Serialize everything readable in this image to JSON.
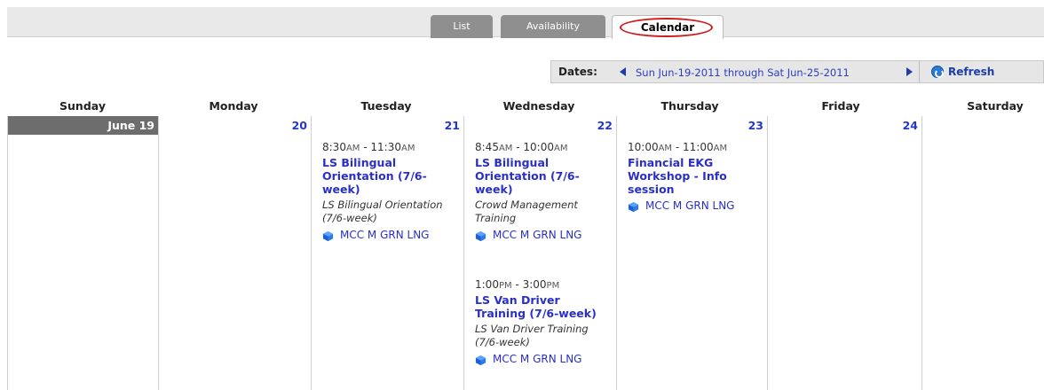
{
  "tabs": {
    "list": "List",
    "availability": "Availability",
    "calendar": "Calendar"
  },
  "dates": {
    "label": "Dates:",
    "range": "Sun Jun-19-2011 through Sat Jun-25-2011",
    "refresh": "Refresh"
  },
  "days": {
    "sunday": "Sunday",
    "monday": "Monday",
    "tuesday": "Tuesday",
    "wednesday": "Wednesday",
    "thursday": "Thursday",
    "friday": "Friday",
    "saturday": "Saturday"
  },
  "dates_nums": {
    "sun": "June 19",
    "mon": "20",
    "tue": "21",
    "wed": "22",
    "thu": "23",
    "fri": "24"
  },
  "events": {
    "tue1": {
      "time_start": "8:30",
      "start_ampm": "AM",
      "time_end": "11:30",
      "end_ampm": "AM",
      "title": "LS Bilingual Orientation (7/6-week)",
      "desc": "LS Bilingual Orientation (7/6-week)",
      "location": "MCC M GRN LNG"
    },
    "wed1": {
      "time_start": "8:45",
      "start_ampm": "AM",
      "time_end": "10:00",
      "end_ampm": "AM",
      "title": "LS Bilingual Orientation (7/6-week)",
      "desc": "Crowd Management Training",
      "location": "MCC M GRN LNG"
    },
    "wed2": {
      "time_start": "1:00",
      "start_ampm": "PM",
      "time_end": "3:00",
      "end_ampm": "PM",
      "title": "LS Van Driver Training (7/6-week)",
      "desc": "LS Van Driver Training (7/6-week)",
      "location": "MCC M GRN LNG"
    },
    "thu1": {
      "time_start": "10:00",
      "start_ampm": "AM",
      "time_end": "11:00",
      "end_ampm": "AM",
      "title": "Financial EKG Workshop - Info session",
      "location": "MCC M GRN LNG"
    }
  },
  "colors": {
    "link": "#2a2fc8",
    "highlight_oval": "#d01818",
    "tab_inactive": "#8f8f8f"
  }
}
